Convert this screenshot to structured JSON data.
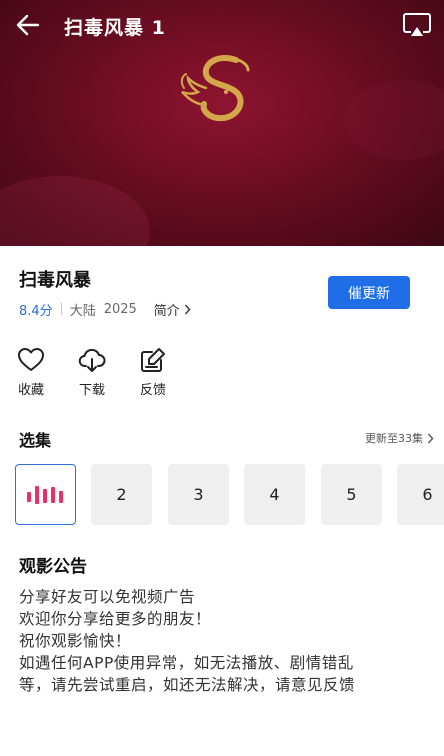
{
  "player": {
    "title": "扫毒风暴 1",
    "bg_color": "#6b0d22",
    "logo_color": "#d4a84a",
    "icons": {
      "back": "back-arrow-icon",
      "cast": "cast-screen-icon",
      "logo": "dragon-logo-icon"
    }
  },
  "info": {
    "title": "扫毒风暴",
    "rating": "8.4分",
    "region": "大陆",
    "year": "2025",
    "intro_label": "简介",
    "update_button": "催更新",
    "accent_color": "#1f6ee8"
  },
  "actions": [
    {
      "label": "收藏",
      "icon": "heart-icon"
    },
    {
      "label": "下载",
      "icon": "cloud-download-icon"
    },
    {
      "label": "反馈",
      "icon": "feedback-edit-icon"
    }
  ],
  "episodes": {
    "title": "选集",
    "update_status": "更新至33集",
    "items": [
      {
        "label": "",
        "playing": true
      },
      {
        "label": "2"
      },
      {
        "label": "3"
      },
      {
        "label": "4"
      },
      {
        "label": "5"
      },
      {
        "label": "6"
      }
    ]
  },
  "notice": {
    "title": "观影公告",
    "lines": [
      "分享好友可以免视频广告",
      "欢迎你分享给更多的朋友！",
      "祝你观影愉快！",
      "如遇任何APP使用异常，如无法播放、剧情错乱",
      "等，请先尝试重启，如还无法解决，请意见反馈"
    ]
  }
}
